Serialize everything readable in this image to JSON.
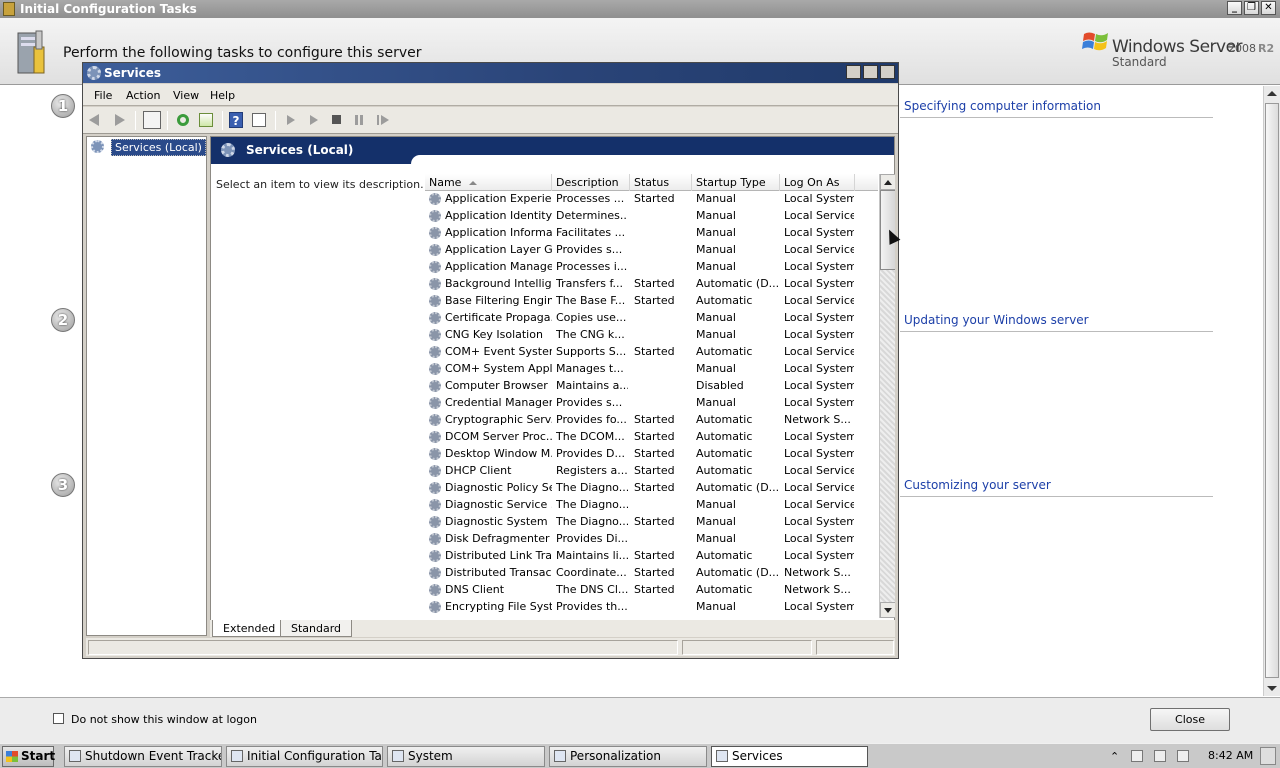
{
  "ict": {
    "title": "Initial Configuration Tasks",
    "heading": "Perform the following tasks to configure this server",
    "brand": {
      "name": "Windows Server",
      "version": "2008",
      "release": "R2",
      "edition": "Standard"
    },
    "steps": [
      "1",
      "2",
      "3"
    ],
    "sections": [
      "Specifying computer information",
      "Updating your Windows server",
      "Customizing your server"
    ],
    "dont_show_label": "Do not show this window at logon",
    "close_label": "Close"
  },
  "services": {
    "title": "Services",
    "menu": [
      "File",
      "Action",
      "View",
      "Help"
    ],
    "tree_item": "Services (Local)",
    "banner_title": "Services (Local)",
    "description_hint": "Select an item to view its description.",
    "columns": [
      "Name",
      "Description",
      "Status",
      "Startup Type",
      "Log On As"
    ],
    "rows": [
      [
        "Application Experie...",
        "Processes ...",
        "Started",
        "Manual",
        "Local System"
      ],
      [
        "Application Identity",
        "Determines...",
        "",
        "Manual",
        "Local Service"
      ],
      [
        "Application Informa...",
        "Facilitates ...",
        "",
        "Manual",
        "Local System"
      ],
      [
        "Application Layer G...",
        "Provides s...",
        "",
        "Manual",
        "Local Service"
      ],
      [
        "Application Manage...",
        "Processes i...",
        "",
        "Manual",
        "Local System"
      ],
      [
        "Background Intellig...",
        "Transfers f...",
        "Started",
        "Automatic (D...",
        "Local System"
      ],
      [
        "Base Filtering Engine",
        "The Base F...",
        "Started",
        "Automatic",
        "Local Service"
      ],
      [
        "Certificate Propaga...",
        "Copies use...",
        "",
        "Manual",
        "Local System"
      ],
      [
        "CNG Key Isolation",
        "The CNG k...",
        "",
        "Manual",
        "Local System"
      ],
      [
        "COM+ Event System",
        "Supports S...",
        "Started",
        "Automatic",
        "Local Service"
      ],
      [
        "COM+ System Appl...",
        "Manages t...",
        "",
        "Manual",
        "Local System"
      ],
      [
        "Computer Browser",
        "Maintains a...",
        "",
        "Disabled",
        "Local System"
      ],
      [
        "Credential Manager",
        "Provides s...",
        "",
        "Manual",
        "Local System"
      ],
      [
        "Cryptographic Serv...",
        "Provides fo...",
        "Started",
        "Automatic",
        "Network S..."
      ],
      [
        "DCOM Server Proc...",
        "The DCOM...",
        "Started",
        "Automatic",
        "Local System"
      ],
      [
        "Desktop Window M...",
        "Provides D...",
        "Started",
        "Automatic",
        "Local System"
      ],
      [
        "DHCP Client",
        "Registers a...",
        "Started",
        "Automatic",
        "Local Service"
      ],
      [
        "Diagnostic Policy Se...",
        "The Diagno...",
        "Started",
        "Automatic (D...",
        "Local Service"
      ],
      [
        "Diagnostic Service ...",
        "The Diagno...",
        "",
        "Manual",
        "Local Service"
      ],
      [
        "Diagnostic System ...",
        "The Diagno...",
        "Started",
        "Manual",
        "Local System"
      ],
      [
        "Disk Defragmenter",
        "Provides Di...",
        "",
        "Manual",
        "Local System"
      ],
      [
        "Distributed Link Tra...",
        "Maintains li...",
        "Started",
        "Automatic",
        "Local System"
      ],
      [
        "Distributed Transac...",
        "Coordinate...",
        "Started",
        "Automatic (D...",
        "Network S..."
      ],
      [
        "DNS Client",
        "The DNS Cl...",
        "Started",
        "Automatic",
        "Network S..."
      ],
      [
        "Encrypting File Syst...",
        "Provides th...",
        "",
        "Manual",
        "Local System"
      ]
    ],
    "tabs": [
      "Extended",
      "Standard"
    ]
  },
  "taskbar": {
    "start": "Start",
    "tasks": [
      "Shutdown Event Tracker",
      "Initial Configuration Tasks",
      "System",
      "Personalization",
      "Services"
    ],
    "time": "8:42 AM"
  }
}
